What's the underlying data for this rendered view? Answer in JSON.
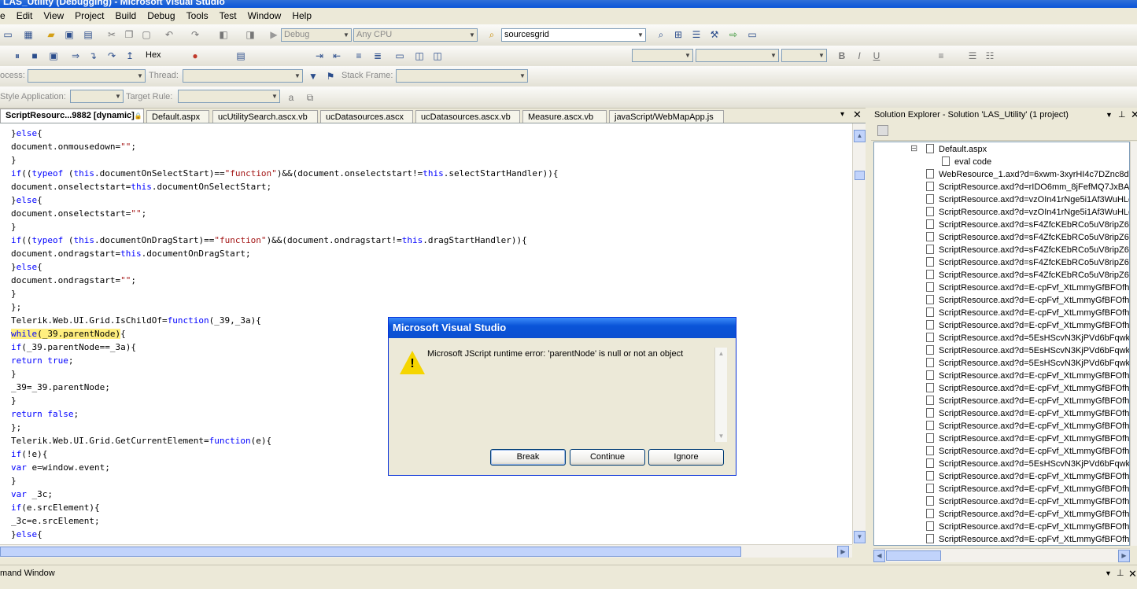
{
  "window": {
    "title": "LAS_Utility (Debugging) - Microsoft Visual Studio"
  },
  "menu": [
    "File",
    "Edit",
    "View",
    "Project",
    "Build",
    "Debug",
    "Tools",
    "Test",
    "Window",
    "Help"
  ],
  "menu_visible": [
    "e",
    "Edit",
    "View",
    "Project",
    "Build",
    "Debug",
    "Tools",
    "Test",
    "Window",
    "Help"
  ],
  "toolbar1": {
    "config": "Debug",
    "platform": "Any CPU",
    "find": "sourcesgrid"
  },
  "toolbar2": {
    "hex_label": "Hex"
  },
  "toolbar3": {
    "process_label": "ocess:",
    "thread_label": "Thread:",
    "stack_label": "Stack Frame:"
  },
  "toolbar4": {
    "style_app_label": "Style Application:",
    "target_rule_label": "Target Rule:"
  },
  "tabs": [
    {
      "label": "ScriptResourc...9882 [dynamic]",
      "active": true
    },
    {
      "label": "Default.aspx"
    },
    {
      "label": "ucUtilitySearch.ascx.vb"
    },
    {
      "label": "ucDatasources.ascx"
    },
    {
      "label": "ucDatasources.ascx.vb"
    },
    {
      "label": "Measure.ascx.vb"
    },
    {
      "label": "javaScript/WebMapApp.js"
    }
  ],
  "solution_explorer": {
    "title": "Solution Explorer - Solution 'LAS_Utility' (1 project)",
    "items": [
      "Default.aspx",
      "eval code",
      "WebResource_1.axd?d=6xwm-3xyrHI4c7DZnc8d",
      "ScriptResource.axd?d=rIDO6mm_8jFefMQ7JxBAi",
      "ScriptResource.axd?d=vzOIn41rNge5i1Af3WuHLe",
      "ScriptResource.axd?d=vzOIn41rNge5i1Af3WuHLe",
      "ScriptResource.axd?d=sF4ZfcKEbRCo5uV8ripZ6O",
      "ScriptResource.axd?d=sF4ZfcKEbRCo5uV8ripZ6O",
      "ScriptResource.axd?d=sF4ZfcKEbRCo5uV8ripZ6O",
      "ScriptResource.axd?d=sF4ZfcKEbRCo5uV8ripZ6O",
      "ScriptResource.axd?d=sF4ZfcKEbRCo5uV8ripZ6y",
      "ScriptResource.axd?d=E-cpFvf_XtLmmyGfBFOfhb",
      "ScriptResource.axd?d=E-cpFvf_XtLmmyGfBFOfhb",
      "ScriptResource.axd?d=E-cpFvf_XtLmmyGfBFOfhb",
      "ScriptResource.axd?d=E-cpFvf_XtLmmyGfBFOfhb",
      "ScriptResource.axd?d=5EsHScvN3KjPVd6bFqwkn",
      "ScriptResource.axd?d=5EsHScvN3KjPVd6bFqwkn",
      "ScriptResource.axd?d=5EsHScvN3KjPVd6bFqwkn",
      "ScriptResource.axd?d=E-cpFvf_XtLmmyGfBFOfhb",
      "ScriptResource.axd?d=E-cpFvf_XtLmmyGfBFOfhb",
      "ScriptResource.axd?d=E-cpFvf_XtLmmyGfBFOfhb",
      "ScriptResource.axd?d=E-cpFvf_XtLmmyGfBFOfhb",
      "ScriptResource.axd?d=E-cpFvf_XtLmmyGfBFOfhb",
      "ScriptResource.axd?d=E-cpFvf_XtLmmyGfBFOfhb",
      "ScriptResource.axd?d=E-cpFvf_XtLmmyGfBFOfhb",
      "ScriptResource.axd?d=5EsHScvN3KjPVd6bFqwkn",
      "ScriptResource.axd?d=E-cpFvf_XtLmmyGfBFOfhb",
      "ScriptResource.axd?d=E-cpFvf_XtLmmyGfBFOfhb",
      "ScriptResource.axd?d=E-cpFvf_XtLmmyGfBFOfhb",
      "ScriptResource.axd?d=E-cpFvf_XtLmmyGfBFOfhb",
      "ScriptResource.axd?d=E-cpFvf_XtLmmyGfBFOfhb",
      "ScriptResource.axd?d=E-cpFvf_XtLmmyGfBFOfhb",
      "ScriptResource.axd?d=E-cpFvf_XtLmmyGfBFOfhb"
    ]
  },
  "code_lines": [
    "}else{",
    "document.onmousedown=\"\";",
    "}",
    "if((typeof (this.documentOnSelectStart)==\"function\")&&(document.onselectstart!=this.selectStartHandler)){",
    "document.onselectstart=this.documentOnSelectStart;",
    "}else{",
    "document.onselectstart=\"\";",
    "}",
    "if((typeof (this.documentOnDragStart)==\"function\")&&(document.ondragstart!=this.dragStartHandler)){",
    "document.ondragstart=this.documentOnDragStart;",
    "}else{",
    "document.ondragstart=\"\";",
    "}",
    "};",
    "Telerik.Web.UI.Grid.IsChildOf=function(_39,_3a){",
    "while(_39.parentNode){",
    "if(_39.parentNode==_3a){",
    "return true;",
    "}",
    "_39=_39.parentNode;",
    "}",
    "return false;",
    "};",
    "Telerik.Web.UI.Grid.GetCurrentElement=function(e){",
    "if(!e){",
    "var e=window.event;",
    "}",
    "var _3c;",
    "if(e.srcElement){",
    "_3c=e.srcElement;",
    "}else{"
  ],
  "highlight_line": 15,
  "dialog": {
    "title": "Microsoft Visual Studio",
    "message": "Microsoft JScript runtime error: 'parentNode' is null or not an object",
    "buttons": [
      "Break",
      "Continue",
      "Ignore"
    ]
  },
  "command_window": {
    "title": "mand Window"
  }
}
